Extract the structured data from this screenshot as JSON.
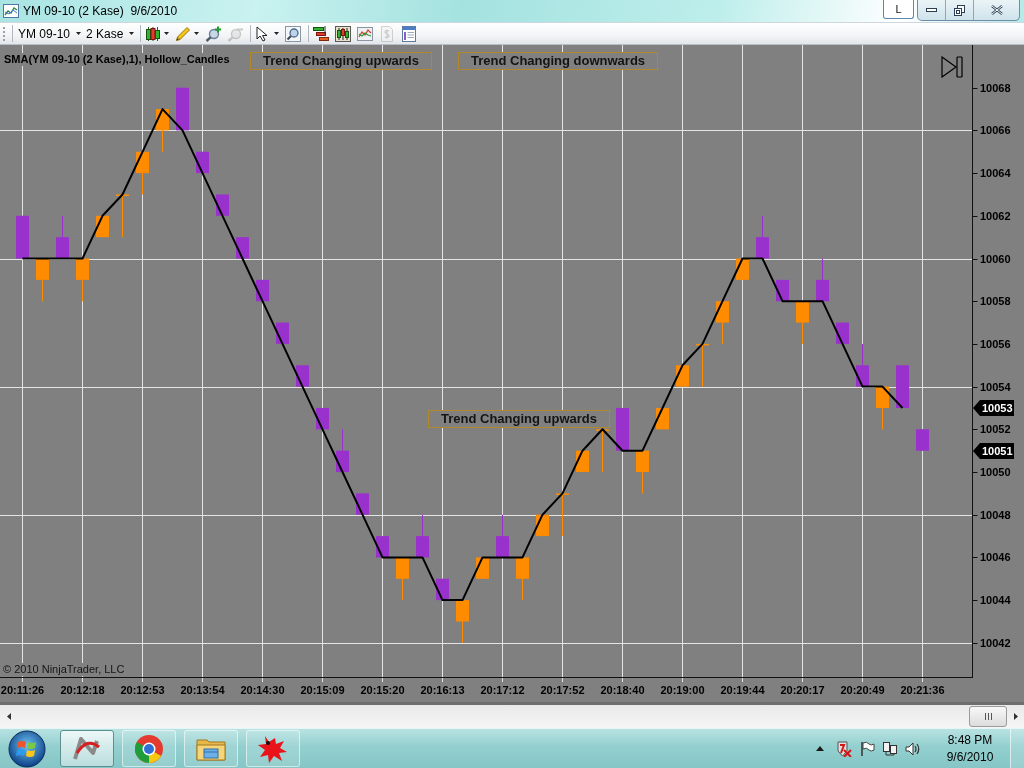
{
  "window": {
    "title": "YM 09-10 (2 Kase)  9/6/2010",
    "mode_button": "L"
  },
  "toolbar": {
    "dropdowns": [
      {
        "label": "YM 09-10"
      },
      {
        "label": "2 Kase"
      }
    ],
    "tool_groups": [
      [
        {
          "menu": true,
          "disabled": false
        },
        {
          "menu": true,
          "disabled": false
        },
        {
          "menu": false,
          "disabled": false
        },
        {
          "menu": false,
          "disabled": true
        }
      ],
      [
        {
          "menu": true,
          "disabled": false
        },
        {
          "menu": false,
          "disabled": false
        }
      ],
      [
        {
          "menu": false,
          "disabled": false
        },
        {
          "menu": false,
          "disabled": false
        },
        {
          "menu": false,
          "disabled": false
        },
        {
          "menu": false,
          "disabled": true
        },
        {
          "menu": false,
          "disabled": false
        }
      ]
    ]
  },
  "chart": {
    "copyright": "© 2010 NinjaTrader, LLC",
    "chart_data": {
      "type": "candlestick",
      "title": "SMA(YM 09-10 (2 Kase),1), Hollow_Candles",
      "categories": [
        "20:11:26",
        null,
        null,
        "20:12:18",
        null,
        null,
        "20:12:53",
        null,
        null,
        "20:13:54",
        null,
        null,
        "20:14:30",
        null,
        null,
        "20:15:09",
        null,
        null,
        "20:15:20",
        null,
        null,
        "20:16:13",
        null,
        null,
        "20:17:12",
        null,
        null,
        "20:17:52",
        null,
        null,
        "20:18:40",
        null,
        null,
        "20:19:00",
        null,
        null,
        "20:19:44",
        null,
        null,
        "20:20:17",
        null,
        null,
        "20:20:49",
        null,
        null,
        "20:21:36"
      ],
      "series": [
        {
          "type": "candlestick",
          "colors": [
            "#9932cc",
            "#ff8c00",
            "#9932cc",
            "#ff8c00",
            "#ff8c00",
            "#ff8c00",
            "#ff8c00",
            "#ff8c00",
            "#9932cc",
            "#9932cc",
            "#9932cc",
            "#9932cc",
            "#9932cc",
            "#9932cc",
            "#9932cc",
            "#9932cc",
            "#9932cc",
            "#9932cc",
            "#9932cc",
            "#ff8c00",
            "#9932cc",
            "#9932cc",
            "#ff8c00",
            "#ff8c00",
            "#9932cc",
            "#ff8c00",
            "#ff8c00",
            "#ff8c00",
            "#ff8c00",
            "#ff8c00",
            "#9932cc",
            "#ff8c00",
            "#ff8c00",
            "#ff8c00",
            "#ff8c00",
            "#ff8c00",
            "#ff8c00",
            "#9932cc",
            "#9932cc",
            "#ff8c00",
            "#9932cc",
            "#9932cc",
            "#9932cc",
            "#ff8c00",
            "#9932cc",
            "#9932cc"
          ],
          "ohlc": [
            [
              10062,
              10062,
              10060,
              10060
            ],
            [
              10059,
              10060,
              10058,
              10060
            ],
            [
              10061,
              10062,
              10060,
              10060
            ],
            [
              10059,
              10060,
              10058,
              10060
            ],
            [
              10061,
              10062,
              10061,
              10062
            ],
            [
              10063,
              10063,
              10061,
              10063
            ],
            [
              10064,
              10065,
              10063,
              10065
            ],
            [
              10066,
              10067,
              10065,
              10067
            ],
            [
              10068,
              10068,
              10066,
              10066
            ],
            [
              10065,
              10065,
              10064,
              10064
            ],
            [
              10063,
              10063,
              10062,
              10062
            ],
            [
              10061,
              10061,
              10060,
              10060
            ],
            [
              10059,
              10059,
              10058,
              10058
            ],
            [
              10057,
              10057,
              10056,
              10056
            ],
            [
              10055,
              10055,
              10054,
              10054
            ],
            [
              10053,
              10053,
              10052,
              10052
            ],
            [
              10051,
              10052,
              10050,
              10050
            ],
            [
              10049,
              10049,
              10048,
              10048
            ],
            [
              10047,
              10047,
              10046,
              10046
            ],
            [
              10045,
              10046,
              10044,
              10046
            ],
            [
              10047,
              10048,
              10046,
              10046
            ],
            [
              10045,
              10045,
              10044,
              10044
            ],
            [
              10043,
              10044,
              10042,
              10044
            ],
            [
              10045,
              10046,
              10045,
              10046
            ],
            [
              10047,
              10048,
              10046,
              10046
            ],
            [
              10045,
              10046,
              10044,
              10046
            ],
            [
              10047,
              10048,
              10047,
              10048
            ],
            [
              10049,
              10049,
              10047,
              10049
            ],
            [
              10050,
              10051,
              10050,
              10051
            ],
            [
              10052,
              10052,
              10050,
              10052
            ],
            [
              10053,
              10053,
              10051,
              10051
            ],
            [
              10050,
              10051,
              10049,
              10051
            ],
            [
              10052,
              10053,
              10052,
              10053
            ],
            [
              10054,
              10055,
              10054,
              10055
            ],
            [
              10056,
              10056,
              10054,
              10056
            ],
            [
              10057,
              10058,
              10056,
              10058
            ],
            [
              10059,
              10060,
              10059,
              10060
            ],
            [
              10061,
              10062,
              10060,
              10060
            ],
            [
              10059,
              10059,
              10058,
              10058
            ],
            [
              10057,
              10058,
              10056,
              10058
            ],
            [
              10059,
              10060,
              10058,
              10058
            ],
            [
              10057,
              10057,
              10056,
              10056
            ],
            [
              10055,
              10056,
              10054,
              10054
            ],
            [
              10053,
              10054,
              10052,
              10054
            ],
            [
              10055,
              10055,
              10053,
              10053
            ],
            [
              10052,
              10052,
              10051,
              10051
            ]
          ]
        },
        {
          "type": "line",
          "color": "#000000",
          "values": [
            10060,
            10060,
            10060,
            10060,
            10062,
            10063,
            10065,
            10067,
            10066,
            10064,
            10062,
            10060,
            10058,
            10056,
            10054,
            10052,
            10050,
            10048,
            10046,
            10046,
            10046,
            10044,
            10044,
            10046,
            10046,
            10046,
            10048,
            10049,
            10051,
            10052,
            10051,
            10051,
            10053,
            10055,
            10056,
            10058,
            10060,
            10060,
            10058,
            10058,
            10058,
            10056,
            10054,
            10054,
            10053,
            null
          ]
        }
      ],
      "ylim": [
        10040.4,
        10070
      ],
      "yticks": [
        10042,
        10044,
        10046,
        10048,
        10050,
        10052,
        10054,
        10056,
        10058,
        10060,
        10062,
        10064,
        10066,
        10068
      ],
      "grid": true,
      "annotations": [
        "Trend Changing upwards",
        "Trend Changing downwards",
        "Trend Changing upwards",
        "10053",
        "10051"
      ]
    }
  },
  "taskbar": {
    "apps": [
      {
        "selected": true
      },
      {
        "selected": false
      },
      {
        "selected": false
      },
      {
        "selected": false
      }
    ],
    "clock": {
      "time": "8:48 PM",
      "date": "9/6/2010"
    }
  }
}
